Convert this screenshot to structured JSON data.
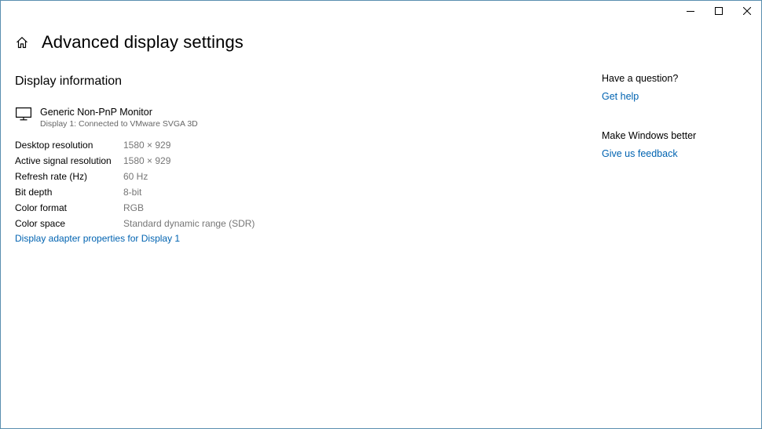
{
  "window": {
    "caption": {
      "minimize_icon": "minimize-icon",
      "maximize_icon": "maximize-icon",
      "close_icon": "close-icon"
    }
  },
  "header": {
    "home_icon": "home-icon",
    "title": "Advanced display settings"
  },
  "display_information": {
    "section_title": "Display information",
    "monitor_icon": "monitor-icon",
    "monitor_name": "Generic Non-PnP Monitor",
    "monitor_sub": "Display 1: Connected to VMware SVGA 3D",
    "rows": [
      {
        "label": "Desktop resolution",
        "value": "1580 × 929"
      },
      {
        "label": "Active signal resolution",
        "value": "1580 × 929"
      },
      {
        "label": "Refresh rate (Hz)",
        "value": "60 Hz"
      },
      {
        "label": "Bit depth",
        "value": "8-bit"
      },
      {
        "label": "Color format",
        "value": "RGB"
      },
      {
        "label": "Color space",
        "value": "Standard dynamic range (SDR)"
      }
    ],
    "adapter_link": "Display adapter properties for Display 1"
  },
  "aside": {
    "question_heading": "Have a question?",
    "help_link": "Get help",
    "better_heading": "Make Windows better",
    "feedback_link": "Give us feedback"
  },
  "colors": {
    "link": "#0063b1",
    "secondary_text": "#767676",
    "border": "#5a8fb0"
  }
}
